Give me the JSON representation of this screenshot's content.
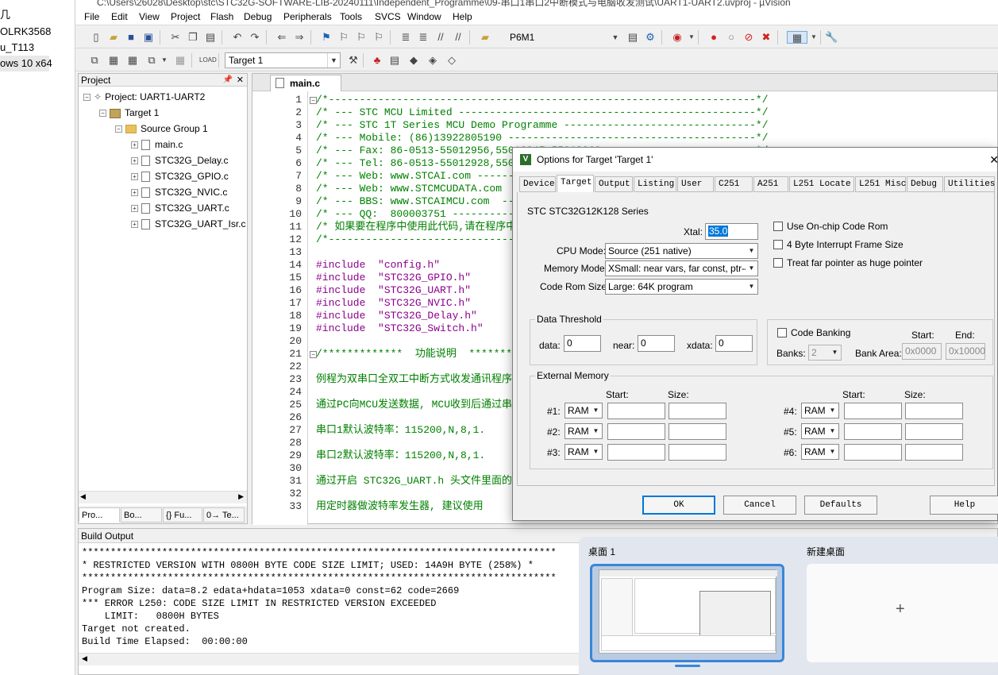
{
  "left_window": {
    "items": [
      "几",
      "OLRK3568",
      "u_T113",
      "ows 10 x64"
    ]
  },
  "window": {
    "title": "C:\\Users\\26028\\Desktop\\stc\\STC32G-SOFTWARE-LIB-20240111\\Independent_Programme\\09-串口1串口2中断模式与电脑收发测试\\UART1-UART2.uvproj - µVision"
  },
  "menu": [
    "File",
    "Edit",
    "View",
    "Project",
    "Flash",
    "Debug",
    "Peripherals",
    "Tools",
    "SVCS",
    "Window",
    "Help"
  ],
  "toolbar": {
    "device_combo": "P6M1",
    "target_combo": "Target 1"
  },
  "project_pane": {
    "title": "Project",
    "root": "Project: UART1-UART2",
    "target": "Target 1",
    "group": "Source Group 1",
    "files": [
      "main.c",
      "STC32G_Delay.c",
      "STC32G_GPIO.c",
      "STC32G_NVIC.c",
      "STC32G_UART.c",
      "STC32G_UART_Isr.c"
    ],
    "tabs": [
      "Pro...",
      "Bo...",
      "{} Fu...",
      "0→ Te..."
    ]
  },
  "editor": {
    "tab": "main.c",
    "line_numbers": [
      "1",
      "2",
      "3",
      "4",
      "5",
      "6",
      "7",
      "8",
      "9",
      "10",
      "11",
      "12",
      "13",
      "14",
      "15",
      "16",
      "17",
      "18",
      "19",
      "20",
      "21",
      "22",
      "23",
      "24",
      "25",
      "26",
      "27",
      "28",
      "29",
      "30",
      "31",
      "32",
      "33"
    ],
    "lines": [
      "/*---------------------------------------------------------------------*/",
      "/* --- STC MCU Limited ------------------------------------------------*/",
      "/* --- STC 1T Series MCU Demo Programme -------------------------------*/",
      "/* --- Mobile: (86)13922805190 ----------------------------------------*/",
      "/* --- Fax: 86-0513-55012956,55012947,55012969 ------------------------*/",
      "/* --- Tel: 86-0513-55012928,55012929,55012966 ------------------------*/",
      "/* --- Web: www.STCAI.com ---------------------------------------------*/",
      "/* --- Web: www.STCMCUDATA.com  ---------------------------------------*/",
      "/* --- BBS: www.STCAIMCU.com  -----------------------------------------*/",
      "/* --- QQ:  800003751 -------------------------------------------------*/",
      "/* 如果要在程序中使用此代码,请在程序中注明使用了STC的资料及程序            */",
      "/*---------------------------------------------------------------------*/",
      "",
      "#include  \"config.h\"",
      "#include  \"STC32G_GPIO.h\"",
      "#include  \"STC32G_UART.h\"",
      "#include  \"STC32G_NVIC.h\"",
      "#include  \"STC32G_Delay.h\"",
      "#include  \"STC32G_Switch.h\"",
      "",
      "/*************  功能说明  **************",
      "",
      "例程为双串口全双工中断方式收发通讯程序。",
      "",
      "通过PC向MCU发送数据, MCU收到后通过串口把收到的数据原样返回.",
      "",
      "串口1默认波特率：115200,N,8,1.",
      "",
      "串口2默认波特率：115200,N,8,1.",
      "",
      "通过开启 STC32G_UART.h 头文件里面的定义,修改波特率.",
      "",
      "用定时器做波特率发生器, 建议使用"
    ]
  },
  "build_output": {
    "title": "Build Output",
    "lines": [
      "***********************************************************************************",
      "* RESTRICTED VERSION WITH 0800H BYTE CODE SIZE LIMIT; USED: 14A9H BYTE (258%) *",
      "***********************************************************************************",
      "Program Size: data=8.2 edata+hdata=1053 xdata=0 const=62 code=2669",
      "*** ERROR L250: CODE SIZE LIMIT IN RESTRICTED VERSION EXCEEDED",
      "    LIMIT:   0800H BYTES",
      "Target not created.",
      "Build Time Elapsed:  00:00:00"
    ]
  },
  "dialog": {
    "title": "Options for Target 'Target 1'",
    "tabs": [
      "Device",
      "Target",
      "Output",
      "Listing",
      "User",
      "C251",
      "A251",
      "L251 Locate",
      "L251 Misc",
      "Debug",
      "Utilities"
    ],
    "series": "STC STC32G12K128 Series",
    "xtal_label": "Xtal:",
    "xtal_value": "35.0",
    "cpu_mode_label": "CPU Mode:",
    "cpu_mode_value": "Source (251 native)",
    "memory_model_label": "Memory Model:",
    "memory_model_value": "XSmall: near vars, far const, ptr-4",
    "code_rom_label": "Code Rom Size:",
    "code_rom_value": "Large: 64K program",
    "checks": [
      "Use On-chip Code Rom",
      "4 Byte Interrupt Frame Size",
      "Treat far pointer as huge pointer"
    ],
    "data_threshold": {
      "title": "Data Threshold",
      "data_label": "data:",
      "data_value": "0",
      "near_label": "near:",
      "near_value": "0",
      "xdata_label": "xdata:",
      "xdata_value": "0"
    },
    "code_banking": {
      "title": "Code Banking",
      "start_label": "Start:",
      "end_label": "End:",
      "banks_label": "Banks:",
      "banks_value": "2",
      "bank_area_label": "Bank Area:",
      "start_value": "0x0000",
      "end_value": "0x10000"
    },
    "external_memory": {
      "title": "External Memory",
      "start_label": "Start:",
      "size_label": "Size:",
      "rows_left": [
        "#1:",
        "#2:",
        "#3:"
      ],
      "rows_right": [
        "#4:",
        "#5:",
        "#6:"
      ],
      "type": "RAM"
    },
    "buttons": {
      "ok": "OK",
      "cancel": "Cancel",
      "defaults": "Defaults",
      "help": "Help"
    }
  },
  "task_view": {
    "desktop1": "桌面 1",
    "new_desktop": "新建桌面",
    "plus": "+"
  }
}
